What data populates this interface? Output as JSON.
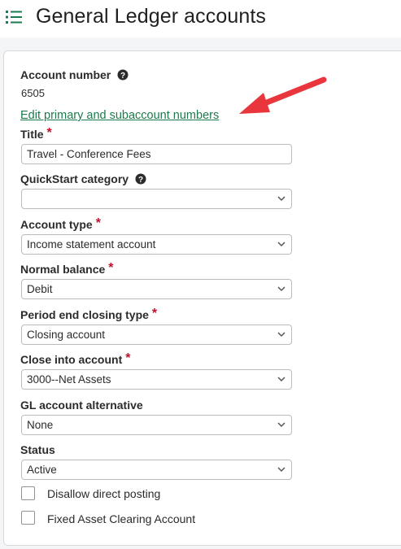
{
  "header": {
    "title": "General Ledger accounts",
    "icon": "list-menu-icon"
  },
  "form": {
    "account_number": {
      "label": "Account number",
      "value": "6505"
    },
    "edit_link": "Edit primary and subaccount numbers",
    "title_field": {
      "label": "Title",
      "value": "Travel - Conference Fees"
    },
    "quickstart": {
      "label": "QuickStart category",
      "value": ""
    },
    "account_type": {
      "label": "Account type",
      "value": "Income statement account"
    },
    "normal_balance": {
      "label": "Normal balance",
      "value": "Debit"
    },
    "closing_type": {
      "label": "Period end closing type",
      "value": "Closing account"
    },
    "close_into": {
      "label": "Close into account",
      "value": "3000--Net Assets"
    },
    "gl_alt": {
      "label": "GL account alternative",
      "value": "None"
    },
    "status": {
      "label": "Status",
      "value": "Active"
    },
    "disallow": {
      "label": "Disallow direct posting",
      "checked": false
    },
    "fixed_asset": {
      "label": "Fixed Asset Clearing Account",
      "checked": false
    },
    "required_mark": "*"
  },
  "colors": {
    "accent_green": "#1d7a4c",
    "required_red": "#c0102a",
    "annotation_arrow": "#e8363c"
  }
}
